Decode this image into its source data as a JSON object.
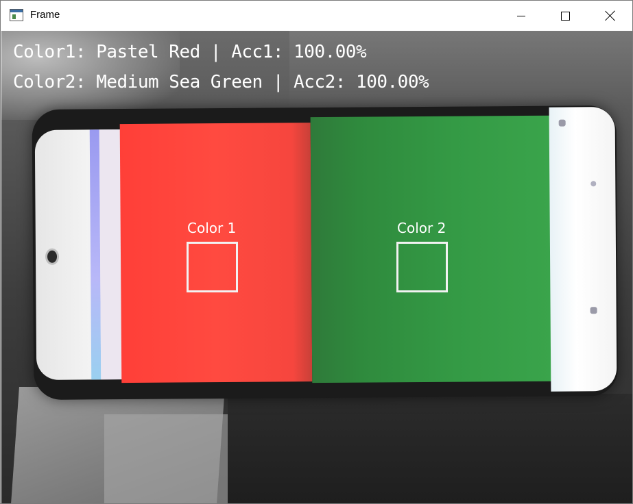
{
  "window": {
    "title": "Frame",
    "icons": {
      "app": "window-app-icon",
      "minimize": "minimize-icon",
      "maximize": "maximize-icon",
      "close": "close-icon"
    }
  },
  "overlay": {
    "line1": "Color1: Pastel Red | Acc1: 100.00%",
    "line2": "Color2: Medium Sea Green | Acc2: 100.00%",
    "color": "#ffffff"
  },
  "regions": [
    {
      "label": "Color 1",
      "color_name": "Pastel Red",
      "accuracy": "100.00%",
      "swatch": "#ff4a40"
    },
    {
      "label": "Color 2",
      "color_name": "Medium Sea Green",
      "accuracy": "100.00%",
      "swatch": "#349a45"
    }
  ]
}
